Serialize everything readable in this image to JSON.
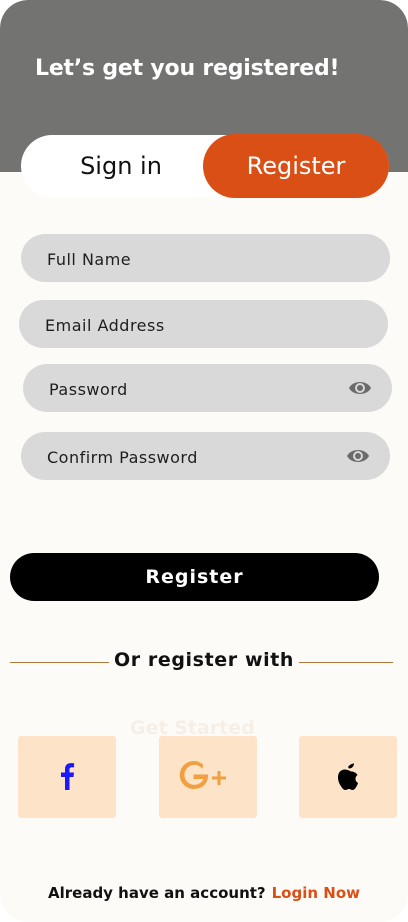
{
  "header": {
    "title": "Let’s get you registered!"
  },
  "tabs": {
    "sign_in": "Sign in",
    "register": "Register"
  },
  "form": {
    "full_name_placeholder": "Full Name",
    "email_placeholder": "Email Address",
    "password_placeholder": "Password",
    "confirm_password_placeholder": "Confirm Password"
  },
  "register_button": "Register",
  "divider_text": "Or register with",
  "ghost_text": "Get Started",
  "social": {
    "facebook": "facebook-icon",
    "google": "google-plus-icon",
    "apple": "apple-icon"
  },
  "footer": {
    "prompt": "Already have an account?",
    "login_link": "Login Now"
  },
  "colors": {
    "accent": "#d94f16",
    "header_bg": "#737472",
    "field_bg": "#d9d9d9",
    "social_bg": "#fde3c8"
  }
}
